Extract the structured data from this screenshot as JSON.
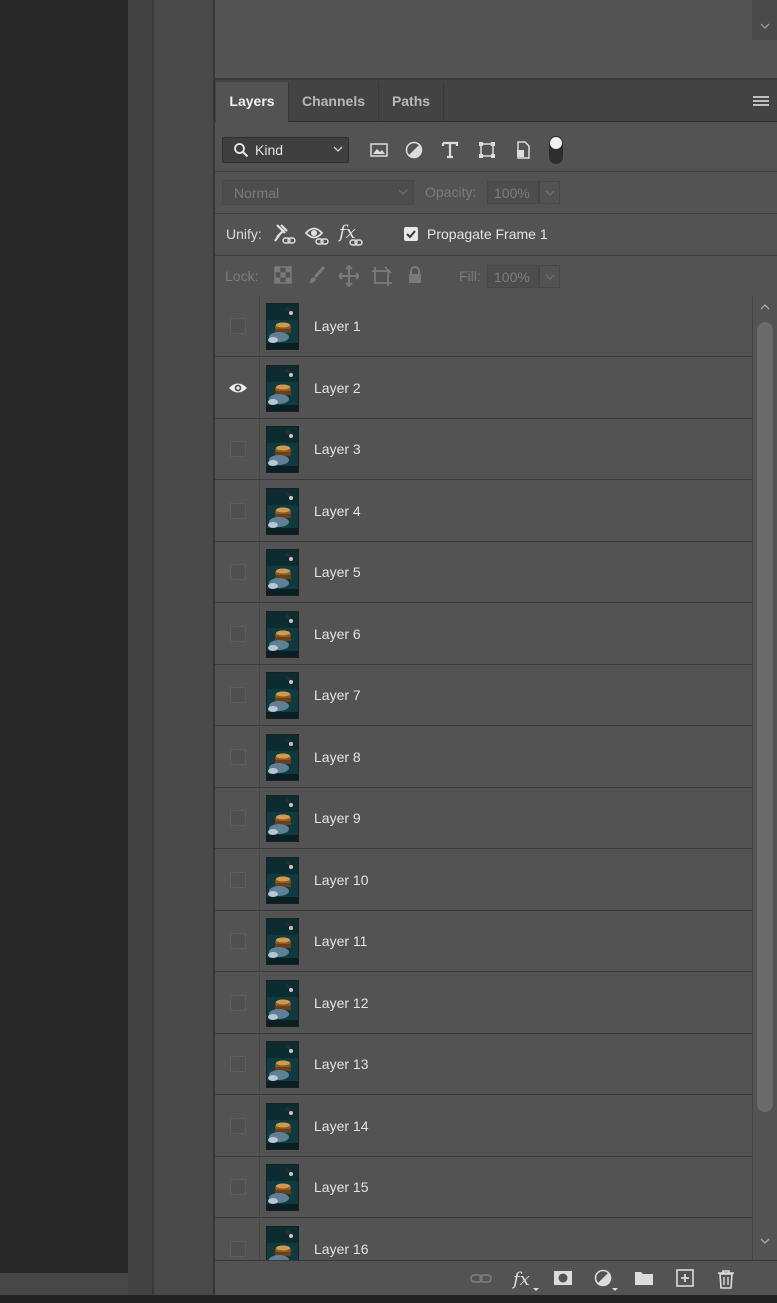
{
  "tabs": [
    {
      "label": "Layers",
      "active": true
    },
    {
      "label": "Channels",
      "active": false
    },
    {
      "label": "Paths",
      "active": false
    }
  ],
  "filter": {
    "kind_label": "Kind",
    "filter_icons": [
      "image-filter-icon",
      "adjustment-filter-icon",
      "type-filter-icon",
      "shape-filter-icon",
      "smart-object-filter-icon"
    ]
  },
  "blend": {
    "mode": "Normal",
    "opacity_label": "Opacity:",
    "opacity_value": "100%"
  },
  "unify": {
    "label": "Unify:",
    "propagate_label": "Propagate Frame 1",
    "propagate_checked": true
  },
  "lock": {
    "label": "Lock:",
    "fill_label": "Fill:",
    "fill_value": "100%"
  },
  "layers": [
    {
      "name": "Layer 1",
      "visible": false
    },
    {
      "name": "Layer 2",
      "visible": true
    },
    {
      "name": "Layer 3",
      "visible": false
    },
    {
      "name": "Layer 4",
      "visible": false
    },
    {
      "name": "Layer 5",
      "visible": false
    },
    {
      "name": "Layer 6",
      "visible": false
    },
    {
      "name": "Layer 7",
      "visible": false
    },
    {
      "name": "Layer 8",
      "visible": false
    },
    {
      "name": "Layer 9",
      "visible": false
    },
    {
      "name": "Layer 10",
      "visible": false
    },
    {
      "name": "Layer 11",
      "visible": false
    },
    {
      "name": "Layer 12",
      "visible": false
    },
    {
      "name": "Layer 13",
      "visible": false
    },
    {
      "name": "Layer 14",
      "visible": false
    },
    {
      "name": "Layer 15",
      "visible": false
    },
    {
      "name": "Layer 16",
      "visible": false
    }
  ],
  "footer_icons": [
    "link-layers-icon",
    "fx-icon",
    "add-mask-icon",
    "adjustment-layer-icon",
    "new-group-icon",
    "new-layer-icon",
    "trash-icon"
  ],
  "colors": {
    "panel_bg": "#535353",
    "tab_bar_bg": "#434343",
    "canvas_bg": "#282828",
    "thumb_teal": "#0f3a40"
  }
}
